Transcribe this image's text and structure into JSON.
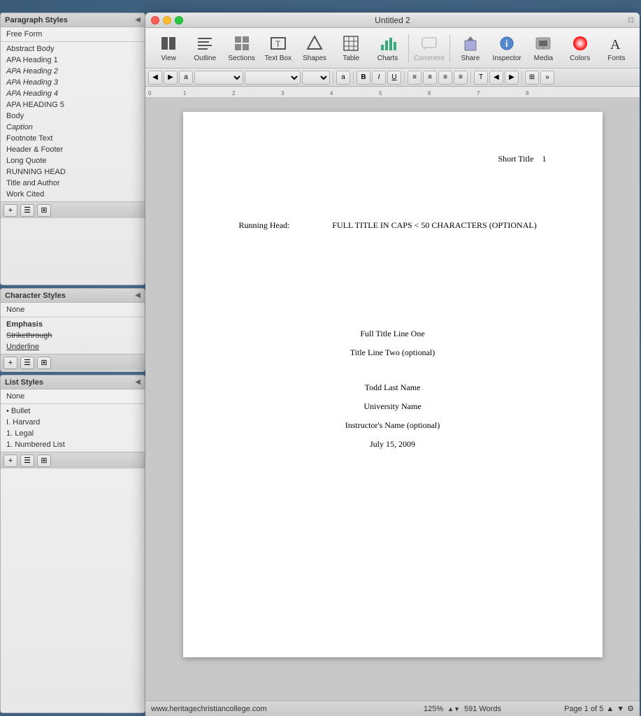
{
  "window": {
    "title": "Untitled 2",
    "resize_btn": "⊡"
  },
  "toolbar": {
    "buttons": [
      {
        "id": "view",
        "label": "View",
        "icon": "⊞"
      },
      {
        "id": "outline",
        "label": "Outline",
        "icon": "☰"
      },
      {
        "id": "sections",
        "label": "Sections",
        "icon": "⊟"
      },
      {
        "id": "textbox",
        "label": "Text Box",
        "icon": "T"
      },
      {
        "id": "shapes",
        "label": "Shapes",
        "icon": "◇"
      },
      {
        "id": "table",
        "label": "Table",
        "icon": "⊞"
      },
      {
        "id": "charts",
        "label": "Charts",
        "icon": "📊"
      },
      {
        "id": "comment",
        "label": "Comment",
        "icon": "💬",
        "disabled": true
      },
      {
        "id": "share",
        "label": "Share",
        "icon": "⬆"
      },
      {
        "id": "inspector",
        "label": "Inspector",
        "icon": "ℹ"
      },
      {
        "id": "media",
        "label": "Media",
        "icon": "🖼"
      },
      {
        "id": "colors",
        "label": "Colors",
        "icon": "🎨"
      },
      {
        "id": "fonts",
        "label": "Fonts",
        "icon": "A"
      }
    ]
  },
  "format_bar": {
    "zoom": "125%",
    "style_dropdown": "",
    "font_dropdown": "",
    "size_dropdown": "",
    "bold": "B",
    "italic": "I",
    "underline": "U"
  },
  "document": {
    "header": {
      "short_title": "Short Title",
      "page_num": "1"
    },
    "running_head": {
      "label": "Running Head:",
      "value": "FULL TITLE IN CAPS < 50 CHARACTERS (OPTIONAL)"
    },
    "body_lines": [
      {
        "text": "Full Title Line One"
      },
      {
        "text": "Title Line Two (optional)"
      },
      {
        "text": ""
      },
      {
        "text": "Todd Last Name"
      },
      {
        "text": "University Name"
      },
      {
        "text": "Instructor's Name (optional)"
      },
      {
        "text": "July 15, 2009"
      }
    ]
  },
  "status_bar": {
    "url": "www.heritagechristiancollege.com",
    "zoom": "125%",
    "words": "591 Words",
    "page_info": "Page 1 of 5",
    "arrows": "▲▼",
    "settings": "⚙"
  },
  "sidebar": {
    "paragraph_styles": {
      "title": "Paragraph Styles",
      "items": [
        {
          "label": "Free Form",
          "style": ""
        },
        {
          "label": "",
          "style": "separator"
        },
        {
          "label": "Abstract Body",
          "style": ""
        },
        {
          "label": "APA Heading 1",
          "style": ""
        },
        {
          "label": "APA Heading 2",
          "style": "italic"
        },
        {
          "label": "APA Heading 3",
          "style": "italic"
        },
        {
          "label": "APA Heading 4",
          "style": "italic"
        },
        {
          "label": "APA HEADING 5",
          "style": ""
        },
        {
          "label": "Body",
          "style": ""
        },
        {
          "label": "Caption",
          "style": "italic"
        },
        {
          "label": "Footnote Text",
          "style": ""
        },
        {
          "label": "Header & Footer",
          "style": ""
        },
        {
          "label": "Long Quote",
          "style": ""
        },
        {
          "label": "RUNNING HEAD",
          "style": ""
        },
        {
          "label": "Title and Author",
          "style": ""
        },
        {
          "label": "Work Cited",
          "style": ""
        }
      ]
    },
    "character_styles": {
      "title": "Character Styles",
      "items": [
        {
          "label": "None",
          "style": ""
        },
        {
          "label": "",
          "style": "separator"
        },
        {
          "label": "Emphasis",
          "style": "bold"
        },
        {
          "label": "Strikethrough",
          "style": "strikethrough"
        },
        {
          "label": "Underline",
          "style": "underline"
        }
      ]
    },
    "list_styles": {
      "title": "List Styles",
      "items": [
        {
          "label": "None",
          "style": ""
        },
        {
          "label": "",
          "style": "separator"
        },
        {
          "label": "• Bullet",
          "style": ""
        },
        {
          "label": "I. Harvard",
          "style": ""
        },
        {
          "label": "1. Legal",
          "style": ""
        },
        {
          "label": "1. Numbered List",
          "style": ""
        }
      ]
    }
  }
}
